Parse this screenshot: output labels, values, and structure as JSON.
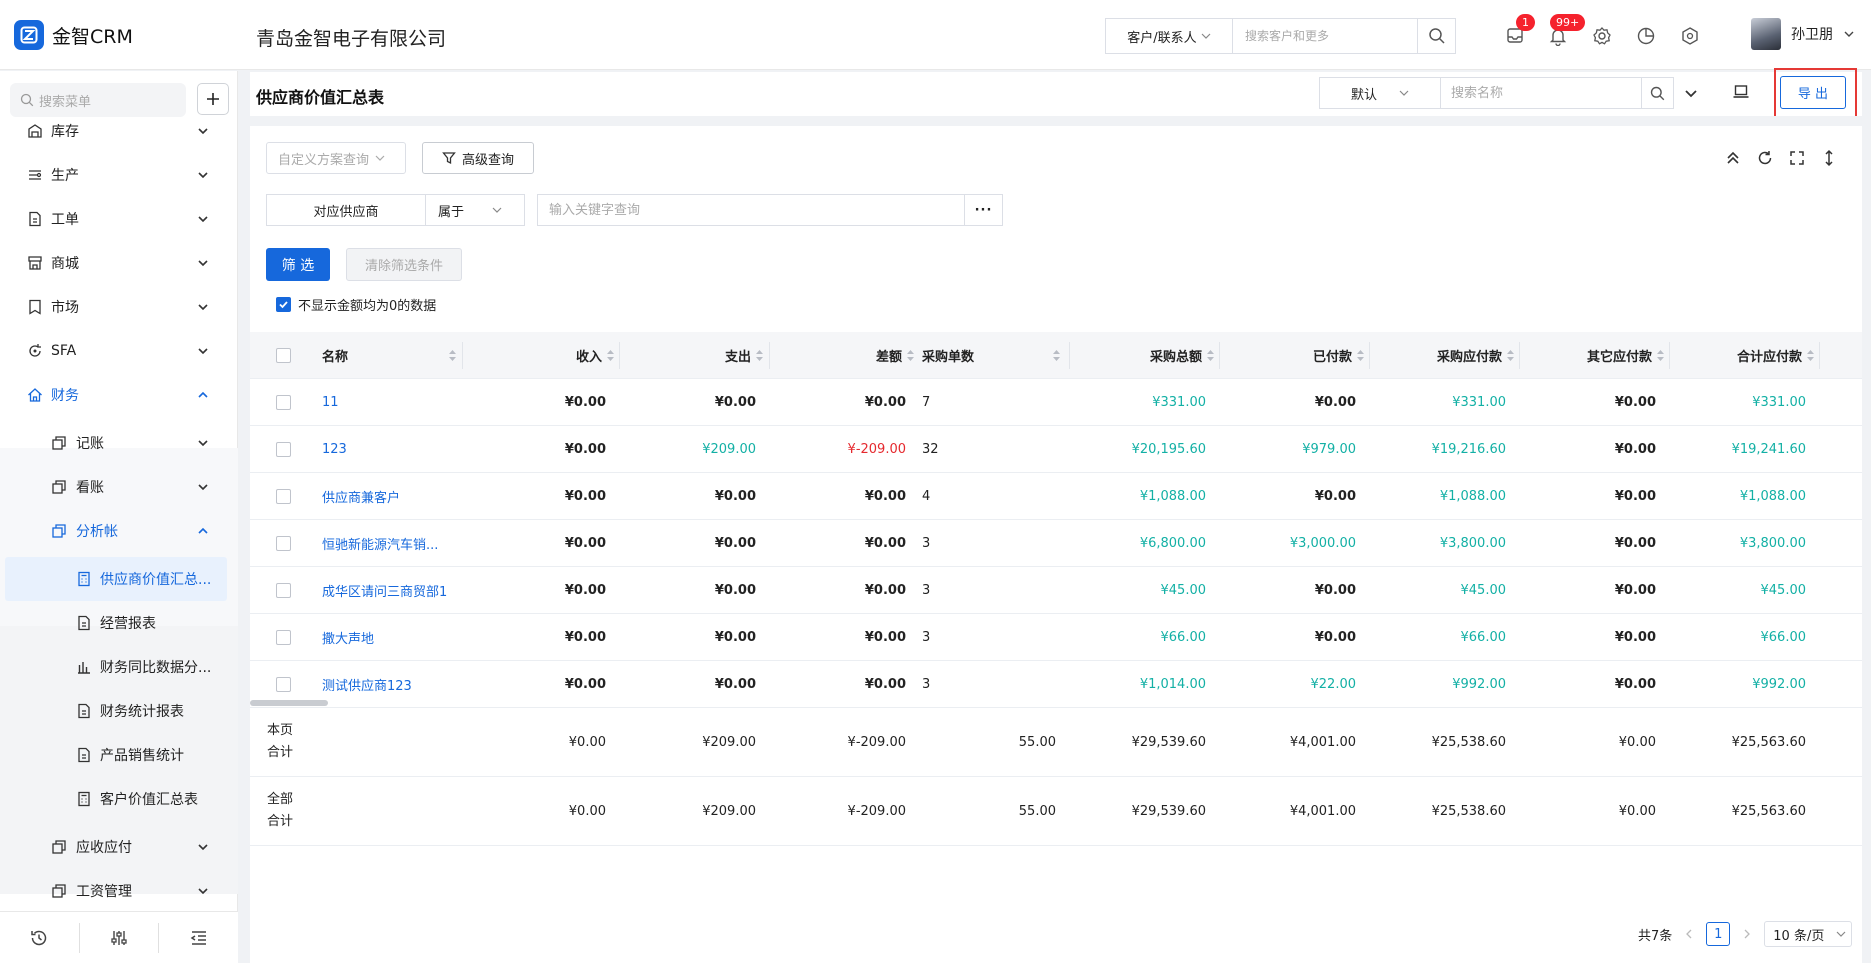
{
  "app": {
    "name": "金智CRM",
    "company": "青岛金智电子有限公司"
  },
  "topbar": {
    "search_type": "客户/联系人",
    "search_placeholder": "搜索客户和更多",
    "badges": {
      "messages": "1",
      "notifications": "99+"
    },
    "user_name": "孙卫朋"
  },
  "sidebar": {
    "search_placeholder": "搜索菜单",
    "items": [
      {
        "label": "库存"
      },
      {
        "label": "生产"
      },
      {
        "label": "工单"
      },
      {
        "label": "商城"
      },
      {
        "label": "市场"
      },
      {
        "label": "SFA"
      },
      {
        "label": "财务"
      },
      {
        "label": "记账"
      },
      {
        "label": "看账"
      },
      {
        "label": "分析帐"
      },
      {
        "label": "供应商价值汇总..."
      },
      {
        "label": "经营报表"
      },
      {
        "label": "财务同比数据分..."
      },
      {
        "label": "财务统计报表"
      },
      {
        "label": "产品销售统计"
      },
      {
        "label": "客户价值汇总表"
      },
      {
        "label": "应收应付"
      },
      {
        "label": "工资管理"
      }
    ]
  },
  "page": {
    "title": "供应商价值汇总表",
    "view": "默认",
    "name_search_placeholder": "搜索名称",
    "export_label": "导 出"
  },
  "filters": {
    "scheme_placeholder": "自定义方案查询",
    "advanced_label": "高级查询",
    "field": "对应供应商",
    "operator": "属于",
    "keyword_placeholder": "输入关键字查询",
    "more": "···",
    "filter_label": "筛 选",
    "clear_label": "清除筛选条件",
    "hide_zero_label": "不显示金额均为0的数据"
  },
  "table": {
    "columns": [
      "名称",
      "收入",
      "支出",
      "差额",
      "采购单数",
      "采购总额",
      "已付款",
      "采购应付款",
      "其它应付款",
      "合计应付款"
    ],
    "rows": [
      [
        "11",
        "¥0.00",
        "¥0.00",
        "¥0.00",
        "7",
        "¥331.00",
        "¥0.00",
        "¥331.00",
        "¥0.00",
        "¥331.00"
      ],
      [
        "123",
        "¥0.00",
        "¥209.00",
        "¥-209.00",
        "32",
        "¥20,195.60",
        "¥979.00",
        "¥19,216.60",
        "¥0.00",
        "¥19,241.60"
      ],
      [
        "供应商兼客户",
        "¥0.00",
        "¥0.00",
        "¥0.00",
        "4",
        "¥1,088.00",
        "¥0.00",
        "¥1,088.00",
        "¥0.00",
        "¥1,088.00"
      ],
      [
        "恒驰新能源汽车销...",
        "¥0.00",
        "¥0.00",
        "¥0.00",
        "3",
        "¥6,800.00",
        "¥3,000.00",
        "¥3,800.00",
        "¥0.00",
        "¥3,800.00"
      ],
      [
        "成华区请问三商贸部1",
        "¥0.00",
        "¥0.00",
        "¥0.00",
        "3",
        "¥45.00",
        "¥0.00",
        "¥45.00",
        "¥0.00",
        "¥45.00"
      ],
      [
        "撒大声地",
        "¥0.00",
        "¥0.00",
        "¥0.00",
        "3",
        "¥66.00",
        "¥0.00",
        "¥66.00",
        "¥0.00",
        "¥66.00"
      ],
      [
        "测试供应商123",
        "¥0.00",
        "¥0.00",
        "¥0.00",
        "3",
        "¥1,014.00",
        "¥22.00",
        "¥992.00",
        "¥0.00",
        "¥992.00"
      ]
    ],
    "summary": [
      {
        "label": "本页合计",
        "values": [
          "¥0.00",
          "¥209.00",
          "¥-209.00",
          "55.00",
          "¥29,539.60",
          "¥4,001.00",
          "¥25,538.60",
          "¥0.00",
          "¥25,563.60"
        ]
      },
      {
        "label": "全部合计",
        "values": [
          "¥0.00",
          "¥209.00",
          "¥-209.00",
          "55.00",
          "¥29,539.60",
          "¥4,001.00",
          "¥25,538.60",
          "¥0.00",
          "¥25,563.60"
        ]
      }
    ]
  },
  "pagination": {
    "total": "共7条",
    "current": "1",
    "page_size": "10 条/页"
  },
  "colors": {
    "primary": "#1668dc",
    "positive": "#13b0a5",
    "negative": "#e5292e",
    "highlight_border": "#e53935"
  }
}
